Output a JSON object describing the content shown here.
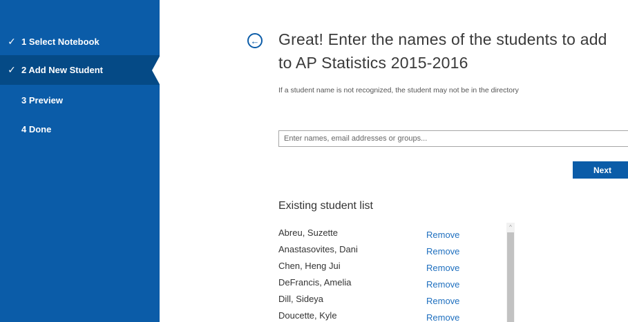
{
  "sidebar": {
    "steps": [
      {
        "label": "1  Select Notebook",
        "completed": true,
        "active": false
      },
      {
        "label": "2  Add New Student",
        "completed": true,
        "active": true
      },
      {
        "label": "3  Preview",
        "completed": false,
        "active": false
      },
      {
        "label": "4  Done",
        "completed": false,
        "active": false
      }
    ],
    "check_glyph": "✓",
    "colors": {
      "background": "#0b5ca8",
      "active": "#054a86"
    }
  },
  "main": {
    "back_icon": "arrow-left-circle-icon",
    "back_glyph": "←",
    "title": "Great! Enter the names of the students to add to AP Statistics 2015-2016",
    "hint": "If a student name is not recognized, the student may not be in the directory",
    "input": {
      "value": "",
      "placeholder": "Enter names, email addresses or groups..."
    },
    "next_label": "Next",
    "existing_title": "Existing student list",
    "students": [
      {
        "name": "Abreu, Suzette",
        "action": "Remove"
      },
      {
        "name": "Anastasovites, Dani",
        "action": "Remove"
      },
      {
        "name": "Chen, Heng Jui",
        "action": "Remove"
      },
      {
        "name": "DeFrancis, Amelia",
        "action": "Remove"
      },
      {
        "name": "Dill, Sideya",
        "action": "Remove"
      },
      {
        "name": "Doucette, Kyle",
        "action": "Remove"
      }
    ],
    "scroll_up_glyph": "^",
    "colors": {
      "accent": "#0b5ca8",
      "link": "#1e6fbf"
    }
  }
}
